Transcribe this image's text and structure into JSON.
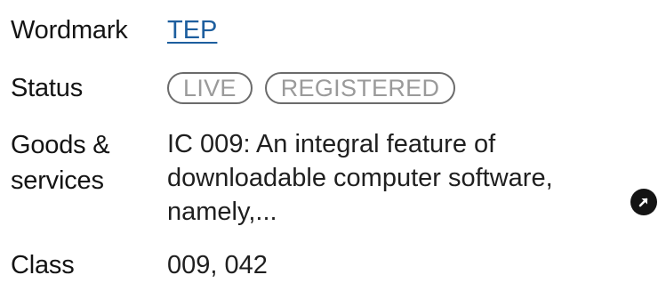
{
  "rows": {
    "wordmark": {
      "label": "Wordmark",
      "value": "TEP"
    },
    "status": {
      "label": "Status",
      "badges": [
        "LIVE",
        "REGISTERED"
      ]
    },
    "goods": {
      "label_line1": "Goods &",
      "label_line2": "services",
      "value": "IC 009: An integral feature of downloadable computer software, namely,..."
    },
    "class": {
      "label": "Class",
      "value": "009, 042"
    }
  },
  "icons": {
    "expand": "arrow-up-right-icon"
  },
  "colors": {
    "link": "#1d5e9e",
    "badge_border": "#6b6b6b",
    "badge_text": "#9a9a9a",
    "icon_bg": "#141414"
  }
}
